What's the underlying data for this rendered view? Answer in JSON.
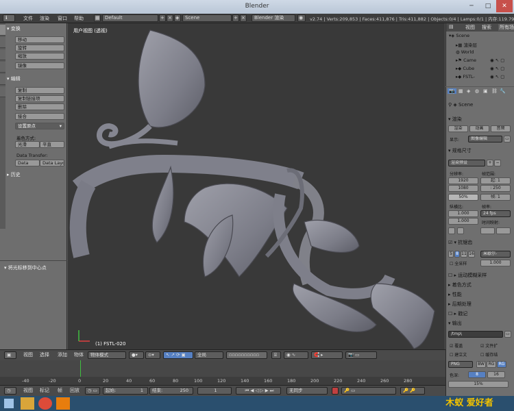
{
  "window": {
    "title": "Blender"
  },
  "info_header": {
    "menus": [
      "文件",
      "渲染",
      "窗口",
      "帮助"
    ],
    "layout": "Default",
    "scene": "Scene",
    "engine": "Blender 渲染",
    "stats": "v2.74 | Verts:209,853 | Faces:411,876 | Tris:411,882 | Objects:0/4 | Lamps:0/1 | 内存:119.79M | FS"
  },
  "toolshelf": {
    "tabs": [
      "工具",
      "创建",
      "关系",
      "动画",
      "物理",
      "蜡笔"
    ],
    "transform_header": "▾ 变换",
    "transform_buttons": [
      "移动",
      "旋转",
      "缩放",
      "镜像"
    ],
    "edit_header": "▾ 编辑",
    "edit_buttons": [
      "复制",
      "复制链接项",
      "删除",
      "接合"
    ],
    "set_origin": "设置原点",
    "shading_label": "着色方式:",
    "smooth": "光滑",
    "flat": "平直",
    "data_transfer_label": "Data Transfer:",
    "data": "Data",
    "data_layout": "Data Layo",
    "history_header": "▸ 历史",
    "operator_header": "▾ 将光标移到中心点"
  },
  "viewport": {
    "title": "用户视图 (透视)",
    "object_label": "(1) FSTL-020"
  },
  "outliner": {
    "view": "视图",
    "search": "搜索",
    "all_scenes": "所有场",
    "items": [
      "Scene",
      "渲染层",
      "World",
      "Came",
      "Cube",
      "FSTL-"
    ]
  },
  "properties": {
    "scene_label": "Scene",
    "render": "▾ 渲染",
    "render_btn": "渲染",
    "anim_btn": "动画",
    "audio_btn": "音频",
    "display_label": "显示:",
    "display_value": "图像编辑",
    "dimensions": "▾ 规格尺寸",
    "preset": "渲染预设",
    "resolution_label": "分辨率:",
    "res_x": "1920",
    "res_y": "1080",
    "res_pct": "50%",
    "frame_range_label": "帧范围:",
    "start": "起: 1",
    "end": ": 250",
    "step": "帧: 1",
    "aspect_label": "纵横比:",
    "aspect_x": "1.000",
    "aspect_y": "1.000",
    "fps_label": "帧率:",
    "fps": "24 fps",
    "time_remap": "时间映射:",
    "antialias": "▾ 抗锯齿",
    "aa_values": [
      "5",
      "8",
      "11",
      "16"
    ],
    "aa_filter": "米歇尔-",
    "full_sample": "全采样",
    "aa_size": "1.000",
    "motion_blur": "▸ 运动模糊采样",
    "shading": "▸ 着色方式",
    "performance": "▸ 性能",
    "post": "▸ 后期处理",
    "stamp": "▸ 戳记",
    "output": "▾ 输出",
    "output_path": "/tmp\\",
    "overwrite": "覆盖",
    "file_ext": "文件扩",
    "placeholders": "建立文",
    "cache": "缓存结",
    "format": "PNG",
    "bw": "BW",
    "rgb": "RG",
    "rgba": "RG",
    "color_depth_label": "色深:",
    "depth_8": "8",
    "depth_16": "16",
    "compression": "15%"
  },
  "viewport_header": {
    "menus": [
      "视图",
      "选择",
      "添加",
      "物体"
    ],
    "mode": "物体模式",
    "pivot": "全局"
  },
  "timeline": {
    "ticks": [
      "-40",
      "-20",
      "0",
      "20",
      "40",
      "60",
      "80",
      "100",
      "120",
      "140",
      "160",
      "180",
      "200",
      "220",
      "240",
      "260",
      "280"
    ]
  },
  "timeline_footer": {
    "menus": [
      "视图",
      "标记",
      "帧",
      "回放"
    ],
    "start_label": "起始:",
    "start_value": "1",
    "end_label": "结束:",
    "end_value": "250",
    "current": "1",
    "sync": "无同步"
  },
  "watermark": "木蚁 爱好者",
  "colors": {
    "accent": "#5680c2",
    "selection": "#f0a000",
    "bg_dark": "#393939",
    "panel": "#6f6f6f"
  }
}
